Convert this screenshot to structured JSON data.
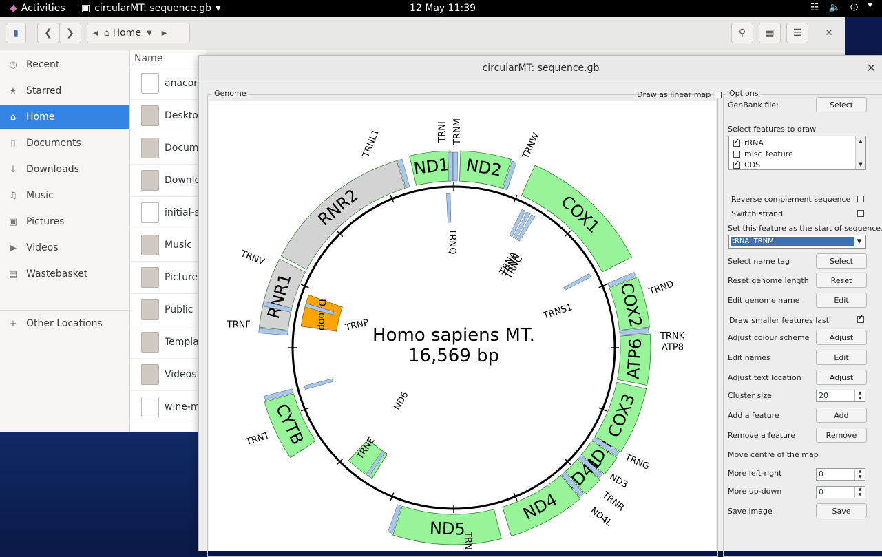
{
  "topbar": {
    "activities": "Activities",
    "app_title": "circularMT: sequence.gb",
    "clock": "12 May  11:39"
  },
  "files": {
    "path_label": "Home",
    "sidebar": [
      {
        "label": "Recent",
        "icon": "clock-icon"
      },
      {
        "label": "Starred",
        "icon": "star-icon"
      },
      {
        "label": "Home",
        "icon": "home-icon",
        "active": true
      },
      {
        "label": "Documents",
        "icon": "document-icon"
      },
      {
        "label": "Downloads",
        "icon": "download-icon"
      },
      {
        "label": "Music",
        "icon": "music-icon"
      },
      {
        "label": "Pictures",
        "icon": "camera-icon"
      },
      {
        "label": "Videos",
        "icon": "video-icon"
      },
      {
        "label": "Wastebasket",
        "icon": "trash-icon"
      }
    ],
    "other_locations": "Other Locations",
    "column_name": "Name",
    "rows": [
      {
        "name": "anacond",
        "type": "doc"
      },
      {
        "name": "Desktop",
        "type": "folder"
      },
      {
        "name": "Docume",
        "type": "folder"
      },
      {
        "name": "Downlo",
        "type": "folder"
      },
      {
        "name": "initial-s",
        "type": "doc"
      },
      {
        "name": "Music",
        "type": "folder"
      },
      {
        "name": "Pictures",
        "type": "folder"
      },
      {
        "name": "Public",
        "type": "folder"
      },
      {
        "name": "Templa",
        "type": "folder"
      },
      {
        "name": "Videos",
        "type": "folder"
      },
      {
        "name": "wine-m",
        "type": "doc"
      }
    ]
  },
  "dialog": {
    "title": "circularMT: sequence.gb",
    "genome_label": "Genome",
    "linear_label": "Draw as linear map",
    "options_label": "Options",
    "genbank_label": "GenBank file:",
    "select_label": "Select",
    "features_label": "Select features to draw",
    "features": [
      {
        "name": "rRNA",
        "checked": true
      },
      {
        "name": "misc_feature",
        "checked": false
      },
      {
        "name": "CDS",
        "checked": true
      }
    ],
    "reverse_label": "Reverse complement sequence",
    "switch_label": "Switch strand",
    "start_label": "Set this feature as the start of sequence.",
    "start_value": "tRNA: TRNM",
    "name_tag_label": "Select name tag",
    "reset_len_label": "Reset genome length",
    "reset_label": "Reset",
    "edit_name_label": "Edit genome name",
    "edit_label": "Edit",
    "smaller_label": "Draw smaller features last",
    "colour_label": "Adjust colour scheme",
    "adjust_label": "Adjust",
    "edit_names_label": "Edit names",
    "text_loc_label": "Adjust text location",
    "cluster_label": "Cluster size",
    "cluster_value": "20",
    "add_feature_label": "Add a feature",
    "add_label": "Add",
    "remove_feature_label": "Remove a feature",
    "remove_label": "Remove",
    "move_label": "Move centre of the map",
    "left_right_label": "More left-right",
    "left_right_value": "0",
    "up_down_label": "More up-down",
    "up_down_value": "0",
    "save_image_label": "Save image",
    "save_label": "Save"
  },
  "genome_map": {
    "title_line1": "Homo sapiens MT.",
    "title_line2": "16,569 bp",
    "colors": {
      "cds": "#98f498",
      "rrna": "#d3d3d3",
      "trna": "#a8c8e8",
      "dloop": "#ffa500"
    },
    "labels": {
      "ND1": "ND1",
      "ND2": "ND2",
      "COX1": "COX1",
      "COX2": "COX2",
      "ATP6": "ATP6",
      "COX3": "COX3",
      "ND4": "ND4",
      "ND5": "ND5",
      "ND6": "ND6",
      "CYTB": "CYTB",
      "RNR1": "RNR1",
      "RNR2": "RNR2",
      "DLOOP": "D-loop",
      "TRNI": "TRNI",
      "TRNM": "TRNM",
      "TRNW": "TRNW",
      "TRNL1": "TRNL1",
      "TRNQ": "TRNQ",
      "TRNA": "TRNA",
      "TRNN": "TRNN",
      "TRNC": "TRNC",
      "TRNY": "TRNY",
      "TRND": "TRND",
      "TRNS1": "TRNS1",
      "TRNK": "TRNK",
      "ATP8": "ATP8",
      "TRNV": "TRNV",
      "TRNF": "TRNF",
      "TRNP": "TRNP",
      "TRNT": "TRNT",
      "TRNE": "TRNE",
      "TRNG": "TRNG",
      "ND3": "ND3",
      "TRNR": "TRNR",
      "ND4L": "ND4L",
      "TRNH": "TRNH"
    }
  }
}
